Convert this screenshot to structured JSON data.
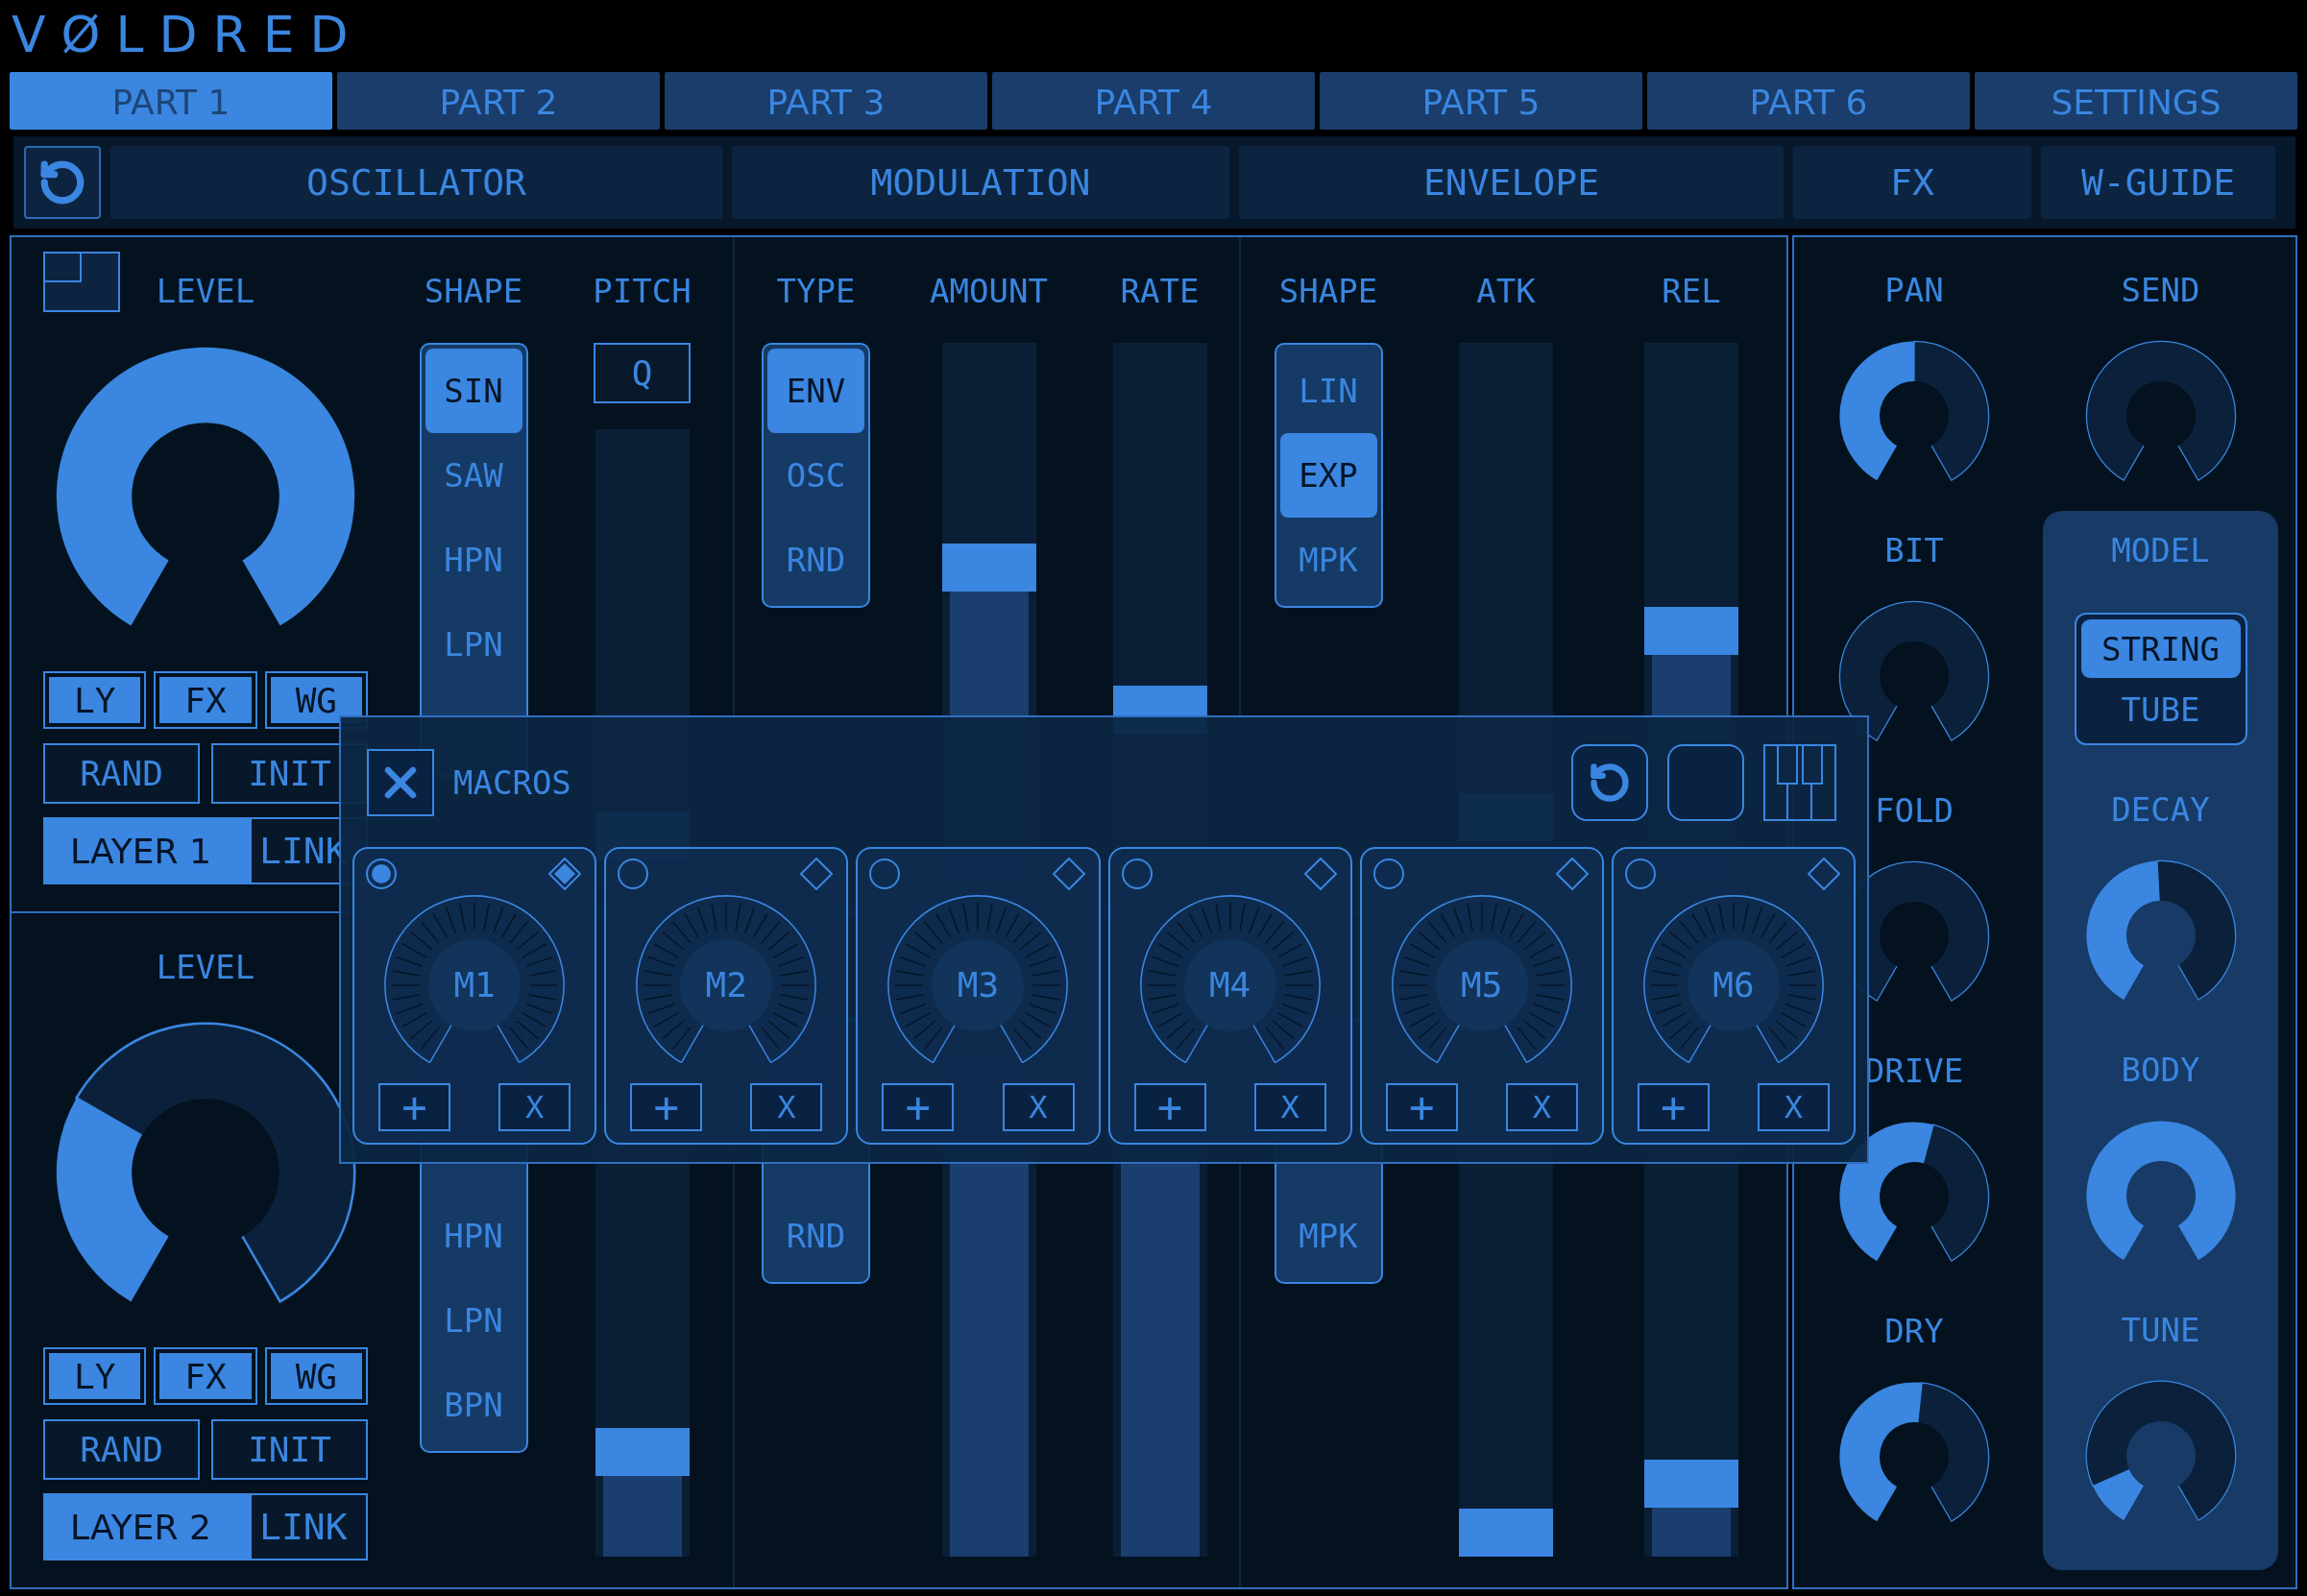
{
  "logo": "VØLDRED",
  "tabs": [
    {
      "label": "PART 1",
      "selected": true
    },
    {
      "label": "PART 2",
      "selected": false
    },
    {
      "label": "PART 3",
      "selected": false
    },
    {
      "label": "PART 4",
      "selected": false
    },
    {
      "label": "PART 5",
      "selected": false
    },
    {
      "label": "PART 6",
      "selected": false
    },
    {
      "label": "SETTINGS",
      "selected": false
    }
  ],
  "sections": [
    "OSCILLATOR",
    "MODULATION",
    "ENVELOPE",
    "FX",
    "W-GUIDE"
  ],
  "layers": [
    {
      "level_label": "LEVEL",
      "toggles": [
        {
          "label": "LY",
          "on": true
        },
        {
          "label": "FX",
          "on": true
        },
        {
          "label": "WG",
          "on": true
        }
      ],
      "actions": [
        "RAND",
        "INIT"
      ],
      "layer_button": {
        "label": "LAYER 1",
        "selected": true
      },
      "link_button": {
        "label": "LINK",
        "selected": false
      },
      "columns": [
        {
          "kind": "options",
          "label": "SHAPE",
          "items": [
            {
              "label": "SIN",
              "selected": true
            },
            {
              "label": "SAW",
              "selected": false
            },
            {
              "label": "HPN",
              "selected": false
            },
            {
              "label": "LPN",
              "selected": false
            }
          ]
        },
        {
          "kind": "slider",
          "label": "PITCH",
          "button": "Q",
          "level": 0.05
        },
        {
          "kind": "options",
          "label": "TYPE",
          "items": [
            {
              "label": "ENV",
              "selected": true
            },
            {
              "label": "OSC",
              "selected": false
            },
            {
              "label": "RND",
              "selected": false
            }
          ]
        },
        {
          "kind": "slider",
          "label": "AMOUNT",
          "level": 0.59
        },
        {
          "kind": "slider",
          "label": "RATE",
          "level": 0.3
        },
        {
          "kind": "options",
          "label": "SHAPE",
          "items": [
            {
              "label": "LIN",
              "selected": false
            },
            {
              "label": "EXP",
              "selected": true
            },
            {
              "label": "MPK",
              "selected": false
            }
          ]
        },
        {
          "kind": "slider",
          "label": "ATK",
          "level": 0.08
        },
        {
          "kind": "slider",
          "label": "REL",
          "level": 0.46
        }
      ]
    },
    {
      "level_label": "LEVEL",
      "toggles": [
        {
          "label": "LY",
          "on": true
        },
        {
          "label": "FX",
          "on": true
        },
        {
          "label": "WG",
          "on": true
        }
      ],
      "actions": [
        "RAND",
        "INIT"
      ],
      "layer_button": {
        "label": "LAYER 2",
        "selected": true
      },
      "link_button": {
        "label": "LINK",
        "selected": false
      },
      "columns": [
        {
          "kind": "options",
          "items": [
            {
              "label": "HPN",
              "selected": false
            },
            {
              "label": "LPN",
              "selected": false
            },
            {
              "label": "BPN",
              "selected": false
            }
          ]
        },
        {
          "kind": "slider",
          "level": 0.2
        },
        {
          "kind": "options",
          "items": [
            {
              "label": "RND",
              "selected": false
            }
          ]
        },
        {
          "kind": "slider",
          "level": 0.93
        },
        {
          "kind": "slider",
          "level": 0.88
        },
        {
          "kind": "options",
          "items": [
            {
              "label": "MPK",
              "selected": false
            }
          ]
        },
        {
          "kind": "slider",
          "level": 0
        },
        {
          "kind": "slider",
          "level": 0.1
        }
      ]
    }
  ],
  "macros": {
    "title": "MACROS",
    "cards": [
      {
        "label": "M1",
        "selected": true,
        "marked": true,
        "add": "+",
        "remove": "X"
      },
      {
        "label": "M2",
        "selected": false,
        "marked": false,
        "add": "+",
        "remove": "X"
      },
      {
        "label": "M3",
        "selected": false,
        "marked": false,
        "add": "+",
        "remove": "X"
      },
      {
        "label": "M4",
        "selected": false,
        "marked": false,
        "add": "+",
        "remove": "X"
      },
      {
        "label": "M5",
        "selected": false,
        "marked": false,
        "add": "+",
        "remove": "X"
      },
      {
        "label": "M6",
        "selected": false,
        "marked": false,
        "add": "+",
        "remove": "X"
      }
    ]
  },
  "fx_knobs": [
    {
      "label": "PAN"
    },
    {
      "label": "BIT"
    },
    {
      "label": "FOLD"
    },
    {
      "label": "DRIVE"
    },
    {
      "label": "DRY"
    }
  ],
  "send": {
    "label": "SEND"
  },
  "model": {
    "label": "MODEL",
    "options": [
      {
        "label": "STRING",
        "selected": true
      },
      {
        "label": "TUBE",
        "selected": false
      }
    ],
    "knobs": [
      {
        "label": "DECAY"
      },
      {
        "label": "BODY"
      },
      {
        "label": "TUNE"
      }
    ]
  }
}
